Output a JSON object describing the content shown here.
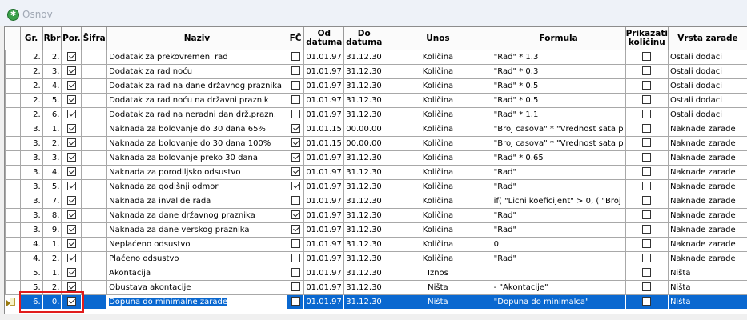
{
  "window": {
    "title": "Osnov"
  },
  "columns": {
    "gr": "Gr.",
    "rbr": "Rbr",
    "por": "Por.",
    "sifra": "Šifra",
    "naziv": "Naziv",
    "fc": "FČ",
    "od_l1": "Od",
    "od_l2": "datuma",
    "do_l1": "Do",
    "do_l2": "datuma",
    "unos": "Unos",
    "formula": "Formula",
    "prik_l1": "Prikazati",
    "prik_l2": "količinu",
    "vrsta": "Vrsta zarade"
  },
  "rows": [
    {
      "gr": "2.",
      "rbr": "2.",
      "por": true,
      "sifra": "",
      "naziv": "Dodatak za prekovremeni rad",
      "fc": false,
      "od": "01.01.97",
      "do": "31.12.30",
      "unos": "Količina",
      "formula": "\"Rad\" * 1.3",
      "prik": false,
      "vrsta": "Ostali dodaci"
    },
    {
      "gr": "2.",
      "rbr": "3.",
      "por": true,
      "sifra": "",
      "naziv": "Dodatak za rad noću",
      "fc": false,
      "od": "01.01.97",
      "do": "31.12.30",
      "unos": "Količina",
      "formula": "\"Rad\" * 0.3",
      "prik": false,
      "vrsta": "Ostali dodaci"
    },
    {
      "gr": "2.",
      "rbr": "4.",
      "por": true,
      "sifra": "",
      "naziv": "Dodatak za rad na dane državnog praznika",
      "fc": false,
      "od": "01.01.97",
      "do": "31.12.30",
      "unos": "Količina",
      "formula": "\"Rad\" * 0.5",
      "prik": false,
      "vrsta": "Ostali dodaci"
    },
    {
      "gr": "2.",
      "rbr": "5.",
      "por": true,
      "sifra": "",
      "naziv": "Dodatak za rad noću na državni praznik",
      "fc": false,
      "od": "01.01.97",
      "do": "31.12.30",
      "unos": "Količina",
      "formula": "\"Rad\" * 0.5",
      "prik": false,
      "vrsta": "Ostali dodaci"
    },
    {
      "gr": "2.",
      "rbr": "6.",
      "por": true,
      "sifra": "",
      "naziv": "Dodatak za rad na neradni dan drž.prazn.",
      "fc": false,
      "od": "01.01.97",
      "do": "31.12.30",
      "unos": "Količina",
      "formula": "\"Rad\" * 1.1",
      "prik": false,
      "vrsta": "Ostali dodaci"
    },
    {
      "gr": "3.",
      "rbr": "1.",
      "por": true,
      "sifra": "",
      "naziv": "Naknada za bolovanje do 30 dana 65%",
      "fc": true,
      "od": "01.01.15",
      "do": "00.00.00",
      "unos": "Količina",
      "formula": "\"Broj casova\" * \"Vrednost sata p",
      "prik": false,
      "vrsta": "Naknade zarade"
    },
    {
      "gr": "3.",
      "rbr": "2.",
      "por": true,
      "sifra": "",
      "naziv": "Naknada za bolovanje do 30 dana 100%",
      "fc": true,
      "od": "01.01.15",
      "do": "00.00.00",
      "unos": "Količina",
      "formula": "\"Broj casova\" * \"Vrednost sata p",
      "prik": false,
      "vrsta": "Naknade zarade"
    },
    {
      "gr": "3.",
      "rbr": "3.",
      "por": true,
      "sifra": "",
      "naziv": "Naknada za bolovanje preko 30 dana",
      "fc": true,
      "od": "01.01.97",
      "do": "31.12.30",
      "unos": "Količina",
      "formula": "\"Rad\" * 0.65",
      "prik": false,
      "vrsta": "Naknade zarade"
    },
    {
      "gr": "3.",
      "rbr": "4.",
      "por": true,
      "sifra": "",
      "naziv": "Naknada za porodiljsko odsustvo",
      "fc": true,
      "od": "01.01.97",
      "do": "31.12.30",
      "unos": "Količina",
      "formula": "\"Rad\"",
      "prik": false,
      "vrsta": "Naknade zarade"
    },
    {
      "gr": "3.",
      "rbr": "5.",
      "por": true,
      "sifra": "",
      "naziv": "Naknada za godišnji odmor",
      "fc": true,
      "od": "01.01.97",
      "do": "31.12.30",
      "unos": "Količina",
      "formula": "\"Rad\"",
      "prik": false,
      "vrsta": "Naknade zarade"
    },
    {
      "gr": "3.",
      "rbr": "7.",
      "por": true,
      "sifra": "",
      "naziv": "Naknada za invalide rada",
      "fc": false,
      "od": "01.01.97",
      "do": "31.12.30",
      "unos": "Količina",
      "formula": "if( \"Licni koeficijent\" > 0, ( \"Broj",
      "prik": false,
      "vrsta": "Naknade zarade"
    },
    {
      "gr": "3.",
      "rbr": "8.",
      "por": true,
      "sifra": "",
      "naziv": "Naknada za dane državnog praznika",
      "fc": true,
      "od": "01.01.97",
      "do": "31.12.30",
      "unos": "Količina",
      "formula": "\"Rad\"",
      "prik": false,
      "vrsta": "Naknade zarade"
    },
    {
      "gr": "3.",
      "rbr": "9.",
      "por": true,
      "sifra": "",
      "naziv": "Naknada za dane verskog praznika",
      "fc": true,
      "od": "01.01.97",
      "do": "31.12.30",
      "unos": "Količina",
      "formula": "\"Rad\"",
      "prik": false,
      "vrsta": "Naknade zarade"
    },
    {
      "gr": "4.",
      "rbr": "1.",
      "por": true,
      "sifra": "",
      "naziv": "Neplaćeno odsustvo",
      "fc": false,
      "od": "01.01.97",
      "do": "31.12.30",
      "unos": "Količina",
      "formula": "0",
      "prik": false,
      "vrsta": "Naknade zarade"
    },
    {
      "gr": "4.",
      "rbr": "2.",
      "por": true,
      "sifra": "",
      "naziv": "Plaćeno odsustvo",
      "fc": false,
      "od": "01.01.97",
      "do": "31.12.30",
      "unos": "Količina",
      "formula": "\"Rad\"",
      "prik": false,
      "vrsta": "Naknade zarade"
    },
    {
      "gr": "5.",
      "rbr": "1.",
      "por": true,
      "sifra": "",
      "naziv": "Akontacija",
      "fc": false,
      "od": "01.01.97",
      "do": "31.12.30",
      "unos": "Iznos",
      "formula": "",
      "prik": false,
      "vrsta": "Ništa"
    },
    {
      "gr": "5.",
      "rbr": "2.",
      "por": true,
      "sifra": "",
      "naziv": "Obustava akontacije",
      "fc": false,
      "od": "01.01.97",
      "do": "31.12.30",
      "unos": "Ništa",
      "formula": "- \"Akontacije\"",
      "prik": false,
      "vrsta": "Ništa"
    },
    {
      "gr": "6.",
      "rbr": "0.",
      "por": true,
      "sifra": "",
      "naziv": "Dopuna do minimalne zarade",
      "fc": false,
      "od": "01.01.97",
      "do": "31.12.30",
      "unos": "Ništa",
      "formula": "\"Dopuna do minimalca\"",
      "prik": false,
      "vrsta": "Ništa",
      "selected": true
    }
  ]
}
